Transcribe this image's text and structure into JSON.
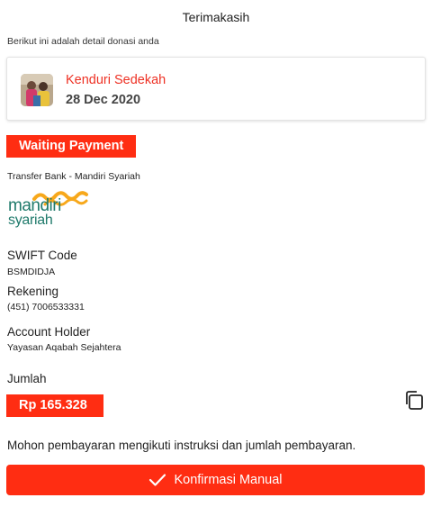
{
  "header": {
    "title": "Terimakasih",
    "subtitle": "Berikut ini adalah detail donasi anda"
  },
  "campaign": {
    "name": "Kenduri Sedekah",
    "date": "28 Dec 2020"
  },
  "status": {
    "label": "Waiting Payment",
    "color": "#ff2d12"
  },
  "payment": {
    "method": "Transfer Bank - Mandiri Syariah",
    "bank_logo": {
      "icon": "mandiri-syariah-logo",
      "word1": "mandiri",
      "word2": "syariah"
    },
    "swift_label": "SWIFT Code",
    "swift_value": "BSMDIDJA",
    "account_label": "Rekening",
    "account_value": "(451) 7006533331",
    "holder_label": "Account Holder",
    "holder_value": "Yayasan Aqabah Sejahtera",
    "amount_label": "Jumlah",
    "amount_value": "Rp 165.328"
  },
  "instruction": "Mohon pembayaran mengikuti instruksi dan jumlah pembayaran.",
  "actions": {
    "confirm_label": "Konfirmasi Manual",
    "confirm_icon": "check-icon",
    "copy_icon": "copy-icon"
  },
  "colors": {
    "accent": "#ff2d12",
    "campaign_text": "#ee3124",
    "logo_orange": "#f7a81b",
    "logo_teal": "#1f7a6b"
  }
}
